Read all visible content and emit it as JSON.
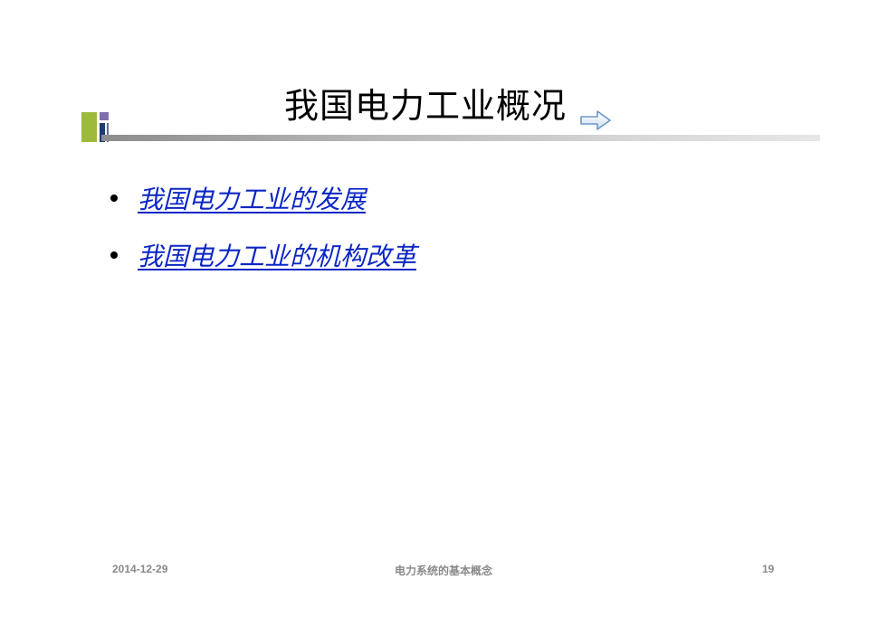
{
  "slide": {
    "title": "我国电力工业概况",
    "nav_icon": "right-arrow-icon",
    "bullets": [
      {
        "label": "我国电力工业的发展"
      },
      {
        "label": "我国电力工业的机构改革"
      }
    ],
    "footer": {
      "date": "2014-12-29",
      "center": "电力系统的基本概念",
      "page_number": "19"
    }
  },
  "colors": {
    "link": "#0b26c4",
    "logo_green": "#9cba3c",
    "logo_purple": "#7f6fa8",
    "logo_navy": "#1f3d6b",
    "footer_text": "#8a8a8a"
  }
}
